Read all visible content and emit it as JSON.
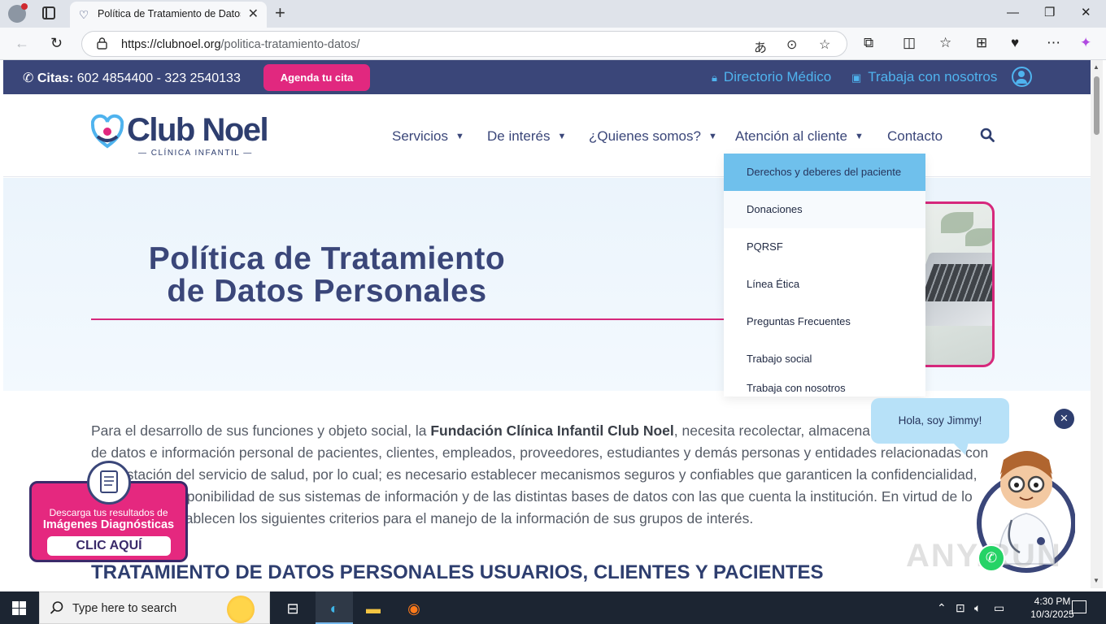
{
  "browser": {
    "tab_title": "Política de Tratamiento de Datos P",
    "url_domain": "https://clubnoel.org",
    "url_path": "/politica-tratamiento-datos/"
  },
  "topbar": {
    "citas_label": "Citas:",
    "phones": "602 4854400 - 323 2540133",
    "cta": "Agenda tu cita",
    "directorio": "Directorio Médico",
    "trabaja": "Trabaja con nosotros"
  },
  "header": {
    "logo_text": "Club Noel",
    "logo_sub": "— CLÍNICA INFANTIL —",
    "menu": [
      {
        "label": "Servicios"
      },
      {
        "label": "De interés"
      },
      {
        "label": "¿Quienes somos?"
      },
      {
        "label": "Atención al cliente"
      },
      {
        "label": "Contacto"
      }
    ]
  },
  "dropdown": {
    "items": [
      "Derechos y deberes del paciente",
      "Donaciones",
      "PQRSF",
      "Línea Ética",
      "Preguntas Frecuentes",
      "Trabajo social",
      "Trabaja con nosotros"
    ]
  },
  "hero": {
    "title_line1": "Política de Tratamiento",
    "title_line2": "de Datos Personales"
  },
  "content": {
    "p_start": "Para el desarrollo de sus funciones y objeto social, la ",
    "p_bold": "Fundación Clínica Infantil Club Noel",
    "p_rest": ", necesita recolectar, almacenar, tratar y disponer de datos e información personal de pacientes, clientes, empleados, proveedores, estudiantes y demás personas y entidades relacionadas con la prestación del servicio de salud, por lo cual; es necesario establecer mecanismos seguros y confiables que garanticen la confidencialidad, integridad y disponibilidad de sus sistemas de información y de las distintas bases de datos con las que cuenta la institución. En virtud de lo anterior; se establecen los siguientes criterios para el manejo de la información de sus grupos de interés.",
    "section_heading": "TRATAMIENTO DE DATOS PERSONALES USUARIOS, CLIENTES Y PACIENTES"
  },
  "widgets": {
    "jimmy_greeting": "Hola, soy Jimmy!",
    "diag_line1": "Descarga tus resultados de",
    "diag_line2": "Imágenes Diagnósticas",
    "diag_button": "CLIC AQUÍ",
    "watermark": "ANY.RUN"
  },
  "taskbar": {
    "search_placeholder": "Type here to search",
    "time": "4:30 PM",
    "date": "10/3/2025"
  },
  "colors": {
    "navy": "#3a4679",
    "pink": "#e1287f",
    "sky": "#4fb3ee",
    "dropdown_active": "#6fc0ec"
  }
}
